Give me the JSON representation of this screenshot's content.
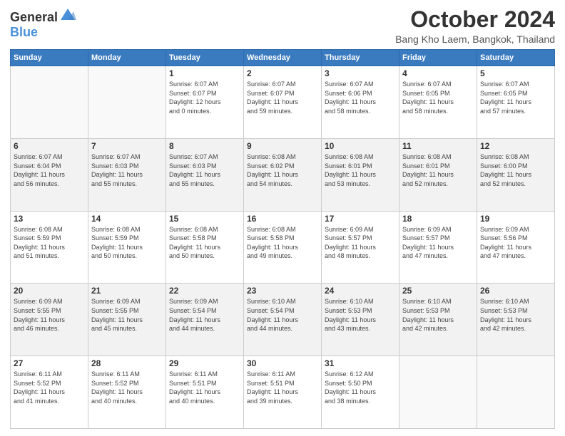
{
  "header": {
    "logo_general": "General",
    "logo_blue": "Blue",
    "month": "October 2024",
    "location": "Bang Kho Laem, Bangkok, Thailand"
  },
  "weekdays": [
    "Sunday",
    "Monday",
    "Tuesday",
    "Wednesday",
    "Thursday",
    "Friday",
    "Saturday"
  ],
  "weeks": [
    [
      {
        "day": "",
        "info": ""
      },
      {
        "day": "",
        "info": ""
      },
      {
        "day": "1",
        "info": "Sunrise: 6:07 AM\nSunset: 6:07 PM\nDaylight: 12 hours\nand 0 minutes."
      },
      {
        "day": "2",
        "info": "Sunrise: 6:07 AM\nSunset: 6:07 PM\nDaylight: 11 hours\nand 59 minutes."
      },
      {
        "day": "3",
        "info": "Sunrise: 6:07 AM\nSunset: 6:06 PM\nDaylight: 11 hours\nand 58 minutes."
      },
      {
        "day": "4",
        "info": "Sunrise: 6:07 AM\nSunset: 6:05 PM\nDaylight: 11 hours\nand 58 minutes."
      },
      {
        "day": "5",
        "info": "Sunrise: 6:07 AM\nSunset: 6:05 PM\nDaylight: 11 hours\nand 57 minutes."
      }
    ],
    [
      {
        "day": "6",
        "info": "Sunrise: 6:07 AM\nSunset: 6:04 PM\nDaylight: 11 hours\nand 56 minutes."
      },
      {
        "day": "7",
        "info": "Sunrise: 6:07 AM\nSunset: 6:03 PM\nDaylight: 11 hours\nand 55 minutes."
      },
      {
        "day": "8",
        "info": "Sunrise: 6:07 AM\nSunset: 6:03 PM\nDaylight: 11 hours\nand 55 minutes."
      },
      {
        "day": "9",
        "info": "Sunrise: 6:08 AM\nSunset: 6:02 PM\nDaylight: 11 hours\nand 54 minutes."
      },
      {
        "day": "10",
        "info": "Sunrise: 6:08 AM\nSunset: 6:01 PM\nDaylight: 11 hours\nand 53 minutes."
      },
      {
        "day": "11",
        "info": "Sunrise: 6:08 AM\nSunset: 6:01 PM\nDaylight: 11 hours\nand 52 minutes."
      },
      {
        "day": "12",
        "info": "Sunrise: 6:08 AM\nSunset: 6:00 PM\nDaylight: 11 hours\nand 52 minutes."
      }
    ],
    [
      {
        "day": "13",
        "info": "Sunrise: 6:08 AM\nSunset: 5:59 PM\nDaylight: 11 hours\nand 51 minutes."
      },
      {
        "day": "14",
        "info": "Sunrise: 6:08 AM\nSunset: 5:59 PM\nDaylight: 11 hours\nand 50 minutes."
      },
      {
        "day": "15",
        "info": "Sunrise: 6:08 AM\nSunset: 5:58 PM\nDaylight: 11 hours\nand 50 minutes."
      },
      {
        "day": "16",
        "info": "Sunrise: 6:08 AM\nSunset: 5:58 PM\nDaylight: 11 hours\nand 49 minutes."
      },
      {
        "day": "17",
        "info": "Sunrise: 6:09 AM\nSunset: 5:57 PM\nDaylight: 11 hours\nand 48 minutes."
      },
      {
        "day": "18",
        "info": "Sunrise: 6:09 AM\nSunset: 5:57 PM\nDaylight: 11 hours\nand 47 minutes."
      },
      {
        "day": "19",
        "info": "Sunrise: 6:09 AM\nSunset: 5:56 PM\nDaylight: 11 hours\nand 47 minutes."
      }
    ],
    [
      {
        "day": "20",
        "info": "Sunrise: 6:09 AM\nSunset: 5:55 PM\nDaylight: 11 hours\nand 46 minutes."
      },
      {
        "day": "21",
        "info": "Sunrise: 6:09 AM\nSunset: 5:55 PM\nDaylight: 11 hours\nand 45 minutes."
      },
      {
        "day": "22",
        "info": "Sunrise: 6:09 AM\nSunset: 5:54 PM\nDaylight: 11 hours\nand 44 minutes."
      },
      {
        "day": "23",
        "info": "Sunrise: 6:10 AM\nSunset: 5:54 PM\nDaylight: 11 hours\nand 44 minutes."
      },
      {
        "day": "24",
        "info": "Sunrise: 6:10 AM\nSunset: 5:53 PM\nDaylight: 11 hours\nand 43 minutes."
      },
      {
        "day": "25",
        "info": "Sunrise: 6:10 AM\nSunset: 5:53 PM\nDaylight: 11 hours\nand 42 minutes."
      },
      {
        "day": "26",
        "info": "Sunrise: 6:10 AM\nSunset: 5:53 PM\nDaylight: 11 hours\nand 42 minutes."
      }
    ],
    [
      {
        "day": "27",
        "info": "Sunrise: 6:11 AM\nSunset: 5:52 PM\nDaylight: 11 hours\nand 41 minutes."
      },
      {
        "day": "28",
        "info": "Sunrise: 6:11 AM\nSunset: 5:52 PM\nDaylight: 11 hours\nand 40 minutes."
      },
      {
        "day": "29",
        "info": "Sunrise: 6:11 AM\nSunset: 5:51 PM\nDaylight: 11 hours\nand 40 minutes."
      },
      {
        "day": "30",
        "info": "Sunrise: 6:11 AM\nSunset: 5:51 PM\nDaylight: 11 hours\nand 39 minutes."
      },
      {
        "day": "31",
        "info": "Sunrise: 6:12 AM\nSunset: 5:50 PM\nDaylight: 11 hours\nand 38 minutes."
      },
      {
        "day": "",
        "info": ""
      },
      {
        "day": "",
        "info": ""
      }
    ]
  ]
}
